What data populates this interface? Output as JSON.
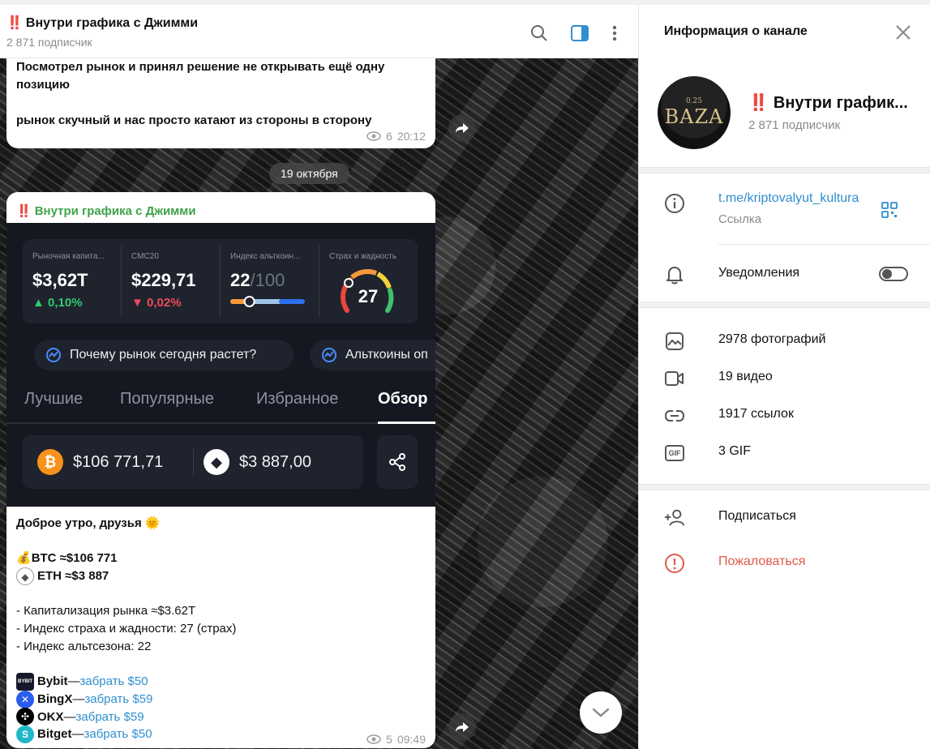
{
  "header": {
    "alert": "‼️",
    "title": "Внутри графика с Джимми",
    "subscribers": "2 871 подписчик"
  },
  "messages": {
    "first": {
      "line1": "Посмотрел рынок и принял решение не открывать ещё одну",
      "line2": "позицию",
      "line3": "рынок скучный и нас просто катают из стороны в сторону",
      "views": "6",
      "time": "20:12"
    },
    "date_divider": "19 октября",
    "second": {
      "alert": "‼️",
      "author": "Внутри графика с Джимми",
      "image": {
        "stats": [
          {
            "label": "Рыночная капита...",
            "value": "$3,62T",
            "change": "▲ 0,10%",
            "change_color": "#2ecc71"
          },
          {
            "label": "CMC20",
            "value": "$229,71",
            "change": "▼ 0,02%",
            "change_color": "#f04a5a"
          },
          {
            "label": "Индекс альткоин...",
            "value": "22",
            "value_dim": "/100",
            "progress": 0.22
          },
          {
            "label": "Страх и жадность",
            "value": "27",
            "gauge": 0.27
          }
        ],
        "chips": [
          "Почему рынок сегодня растет?",
          "Альткоины оп"
        ],
        "tabs": [
          "Лучшие",
          "Популярные",
          "Избранное",
          "Обзор"
        ],
        "active_tab": "Обзор",
        "prices": [
          {
            "coin": "BTC",
            "symbol": "₿",
            "value": "$106 771,71",
            "color": "#f7931a"
          },
          {
            "coin": "ETH",
            "symbol": "◆",
            "value": "$3 887,00",
            "color": "#ffffff"
          }
        ]
      },
      "greeting": "Доброе утро, друзья",
      "greeting_emoji": "🌞",
      "btc_emoji": "💰",
      "btc": "BTC ≈$106 771",
      "eth_icon": "◆",
      "eth": "ETH ≈$3 887",
      "bullets": [
        "- Капитализация рынка ≈$3.62T",
        "- Индекс страха и жадности: 27 (страх)",
        "- Индекс альтсезона: 22"
      ],
      "exchanges": [
        {
          "name": "Bybit",
          "sep": " — ",
          "link": "забрать $50",
          "icon": "BYBIT",
          "color": "#15192a"
        },
        {
          "name": "BingX",
          "sep": " — ",
          "link": "забрать $59",
          "icon": "✕",
          "color": "#2b5cf0"
        },
        {
          "name": "OKX",
          "sep": " — ",
          "link": "забрать $59",
          "icon": "✣",
          "color": "#000000"
        },
        {
          "name": "Bitget",
          "sep": " — ",
          "link": "забрать $50",
          "icon": "S",
          "color": "#20b8c9"
        }
      ],
      "views": "5",
      "time": "09:49"
    }
  },
  "panel": {
    "title": "Информация о канале",
    "avatar_small": "0.25",
    "avatar_big": "BAZA",
    "channel_alert": "‼️",
    "channel_name": "Внутри график...",
    "channel_subs": "2 871 подписчик",
    "link": "t.me/kriptovalyut_kultura",
    "link_label": "Ссылка",
    "notifications": "Уведомления",
    "media": [
      {
        "label": "2978 фотографий",
        "icon": "photo-icon"
      },
      {
        "label": "19 видео",
        "icon": "video-icon"
      },
      {
        "label": "1917 ссылок",
        "icon": "link-icon"
      },
      {
        "label": "3 GIF",
        "icon": "gif-icon"
      }
    ],
    "gif_text": "GIF",
    "subscribe": "Подписаться",
    "report": "Пожаловаться",
    "report_color": "#e05a4a"
  }
}
